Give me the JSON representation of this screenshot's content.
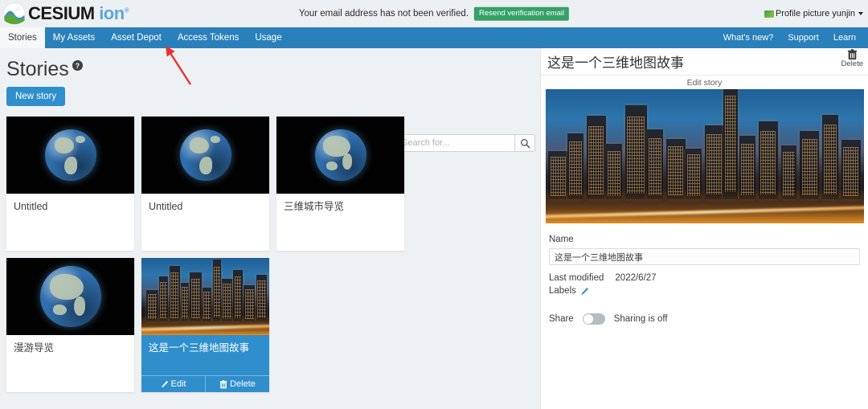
{
  "topbar": {
    "logo_text": "CESIUM",
    "logo_suffix": "ion",
    "logo_tm": "®",
    "verify_message": "Your email address has not been verified.",
    "resend_label": "Resend verification email",
    "profile_name": "Profile picture yunjin",
    "icons": {
      "logo": "cesium-logo-icon",
      "profile": "profile-picture-icon",
      "caret": "chevron-down-icon"
    }
  },
  "nav": {
    "left_items": [
      {
        "label": "Stories",
        "active": true
      },
      {
        "label": "My Assets",
        "active": false
      },
      {
        "label": "Asset Depot",
        "active": false
      },
      {
        "label": "Access Tokens",
        "active": false
      },
      {
        "label": "Usage",
        "active": false
      }
    ],
    "right_items": [
      {
        "label": "What's new?"
      },
      {
        "label": "Support"
      },
      {
        "label": "Learn"
      }
    ],
    "bar_color": "#2980ba"
  },
  "main": {
    "page_title": "Stories",
    "help_glyph": "?",
    "new_story_label": "New story",
    "search_placeholder": "Search for...",
    "search_value": "",
    "search_icon": "search-icon",
    "cards": [
      {
        "title": "Untitled",
        "thumb": "globe-americas",
        "selected": false
      },
      {
        "title": "Untitled",
        "thumb": "globe-americas",
        "selected": false
      },
      {
        "title": "三维城市导览",
        "thumb": "globe-asia",
        "selected": false
      },
      {
        "title": "漫游导览",
        "thumb": "globe-asia",
        "selected": false
      },
      {
        "title": "这是一个三维地图故事",
        "thumb": "city-night",
        "selected": true,
        "actions": [
          {
            "label": "Edit",
            "icon": "pencil-icon"
          },
          {
            "label": "Delete",
            "icon": "trash-icon"
          }
        ]
      }
    ]
  },
  "right_panel": {
    "title": "这是一个三维地图故事",
    "delete_label": "Delete",
    "delete_icon": "trash-icon",
    "subtab_label": "Edit story",
    "hero_image": "city-night-photo",
    "name_label": "Name",
    "name_value": "这是一个三维地图故事",
    "last_modified_label": "Last modified",
    "last_modified_value": "2022/6/27",
    "labels_label": "Labels",
    "labels_edit_icon": "pencil-icon",
    "share_label": "Share",
    "share_status": "Sharing is off",
    "share_on": false
  },
  "annotation": {
    "arrow_color": "#e8332a",
    "points_to": "Access Tokens"
  }
}
